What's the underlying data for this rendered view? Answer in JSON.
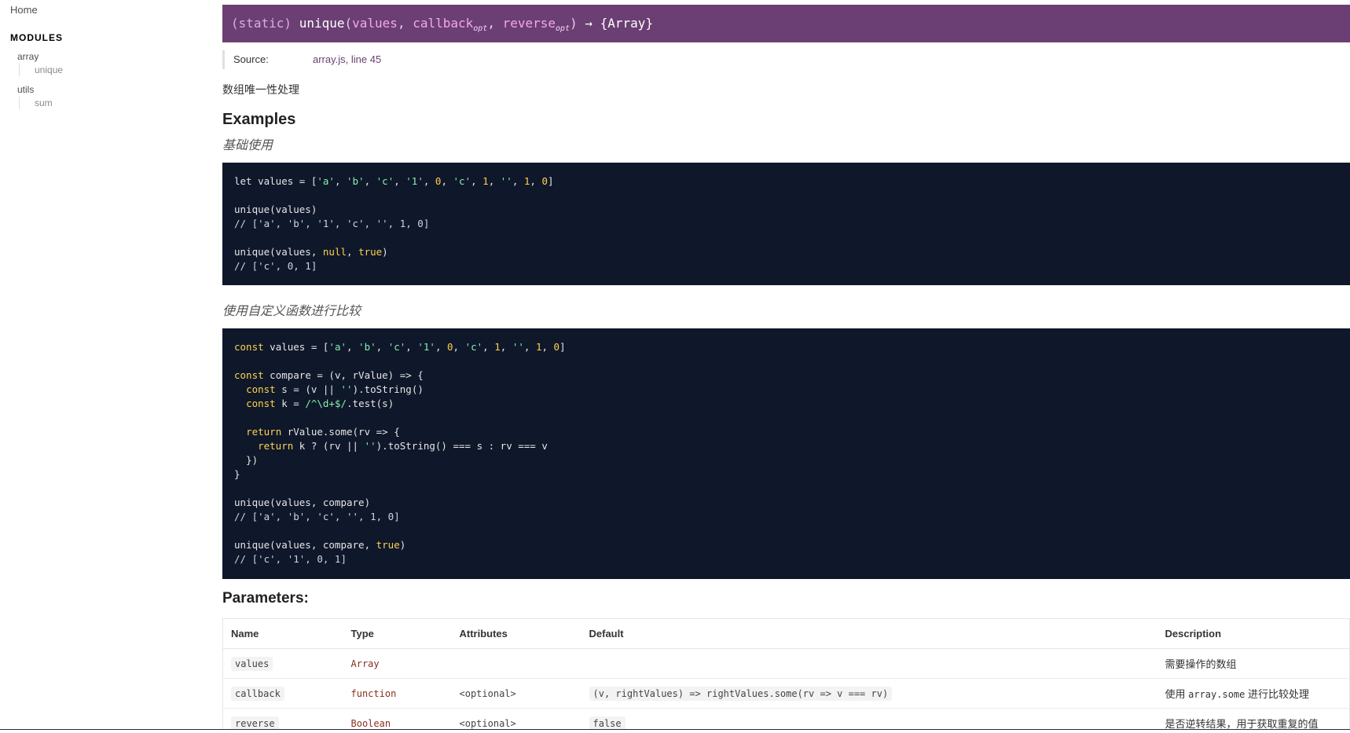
{
  "sidebar": {
    "home": "Home",
    "heading": "MODULES",
    "modules": [
      {
        "label": "array",
        "subs": [
          "unique"
        ]
      },
      {
        "label": "utils",
        "subs": [
          "sum"
        ]
      }
    ]
  },
  "signature": {
    "static": "(static) ",
    "name": "unique",
    "open": "(",
    "p1": "values",
    "sep1": ", ",
    "p2": "callback",
    "p2opt": "opt",
    "sep2": ", ",
    "p3": "reverse",
    "p3opt": "opt",
    "close": ")",
    "arrow": " → ",
    "ret": "{Array}"
  },
  "source": {
    "label": "Source:",
    "file": "array.js",
    "comma": ", ",
    "line": "line 45"
  },
  "description": "数组唯一性处理",
  "examples": {
    "title": "Examples",
    "caption1": "基础使用",
    "caption2": "使用自定义函数进行比较"
  },
  "params": {
    "title": "Parameters:",
    "headers": {
      "name": "Name",
      "type": "Type",
      "attributes": "Attributes",
      "default": "Default",
      "description": "Description"
    },
    "rows": [
      {
        "name": "values",
        "type": "Array",
        "attributes": "",
        "default": "",
        "desc": "需要操作的数组",
        "desc_code": "",
        "desc_post": ""
      },
      {
        "name": "callback",
        "type": "function",
        "attributes": "<optional>",
        "default": "(v, rightValues) => rightValues.some(rv => v === rv)",
        "desc": "使用 ",
        "desc_code": "array.some",
        "desc_post": " 进行比较处理"
      },
      {
        "name": "reverse",
        "type": "Boolean",
        "attributes": "<optional>",
        "default": "false",
        "desc": "是否逆转结果，用于获取重复的值",
        "desc_code": "",
        "desc_post": ""
      }
    ]
  }
}
